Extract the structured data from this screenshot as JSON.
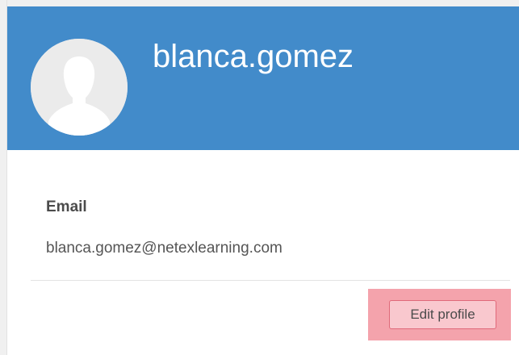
{
  "profile": {
    "username": "blanca.gomez",
    "avatar_icon": "default-user-silhouette-icon",
    "header_color": "#428bca"
  },
  "details": {
    "email_label": "Email",
    "email_value": "blanca.gomez@netexlearning.com"
  },
  "actions": {
    "edit_profile_label": "Edit profile",
    "highlight_color": "#f4a3ac"
  }
}
